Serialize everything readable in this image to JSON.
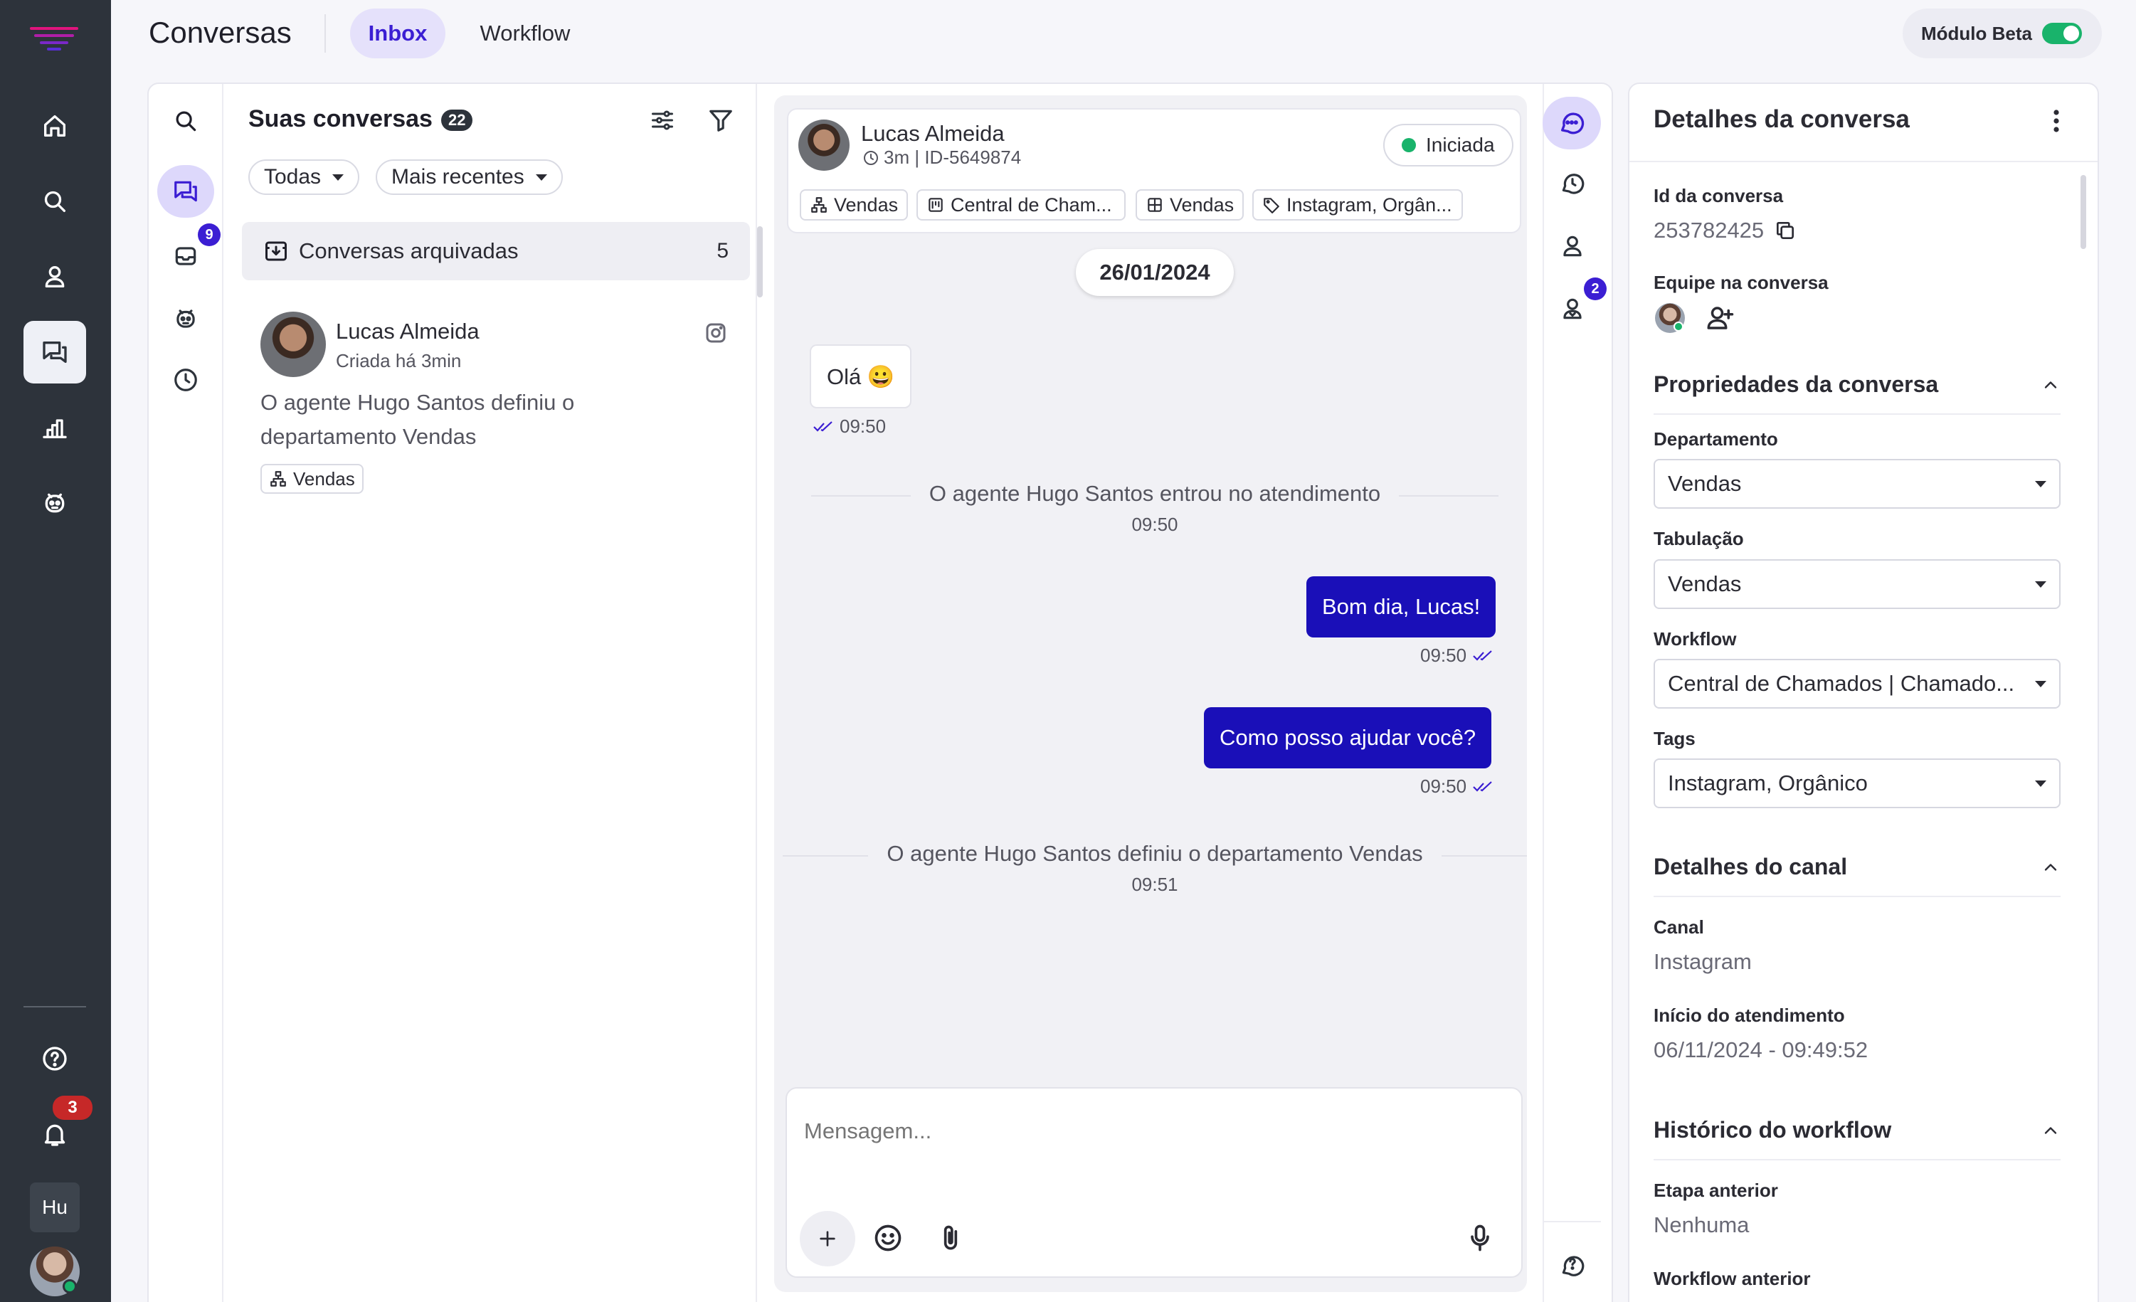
{
  "app": {
    "title": "Conversas",
    "tabs": [
      {
        "label": "Inbox"
      },
      {
        "label": "Workflow"
      }
    ],
    "beta_label": "Módulo Beta"
  },
  "colors": {
    "accent": "#3b1ed3",
    "outgoing_bubble": "#1a0fb8",
    "toggle_on": "#19b36b",
    "rail": "#2d333b",
    "notif_badge": "#c62828"
  },
  "rail": {
    "items": [
      "home-icon",
      "search-icon",
      "user-icon",
      "chat-icon",
      "chart-icon",
      "bot-icon"
    ],
    "bottom": {
      "help": "help-icon",
      "notifications_badge": "3",
      "user_initials": "Hu"
    }
  },
  "inbox_nav": {
    "inbox_badge": "9"
  },
  "list": {
    "title": "Suas conversas",
    "count": "22",
    "filter_all": "Todas",
    "sort": "Mais recentes",
    "archived_label": "Conversas arquivadas",
    "archived_count": "5",
    "items": [
      {
        "name": "Lucas Almeida",
        "created": "Criada há 3min",
        "preview": "O agente Hugo Santos definiu o departamento Vendas",
        "tag": "Vendas",
        "channel_icon": "instagram-icon"
      }
    ]
  },
  "chat": {
    "contact_name": "Lucas Almeida",
    "meta": "3m | ID-5649874",
    "status": "Iniciada",
    "chips": [
      "Vendas",
      "Central de Cham...",
      "Vendas",
      "Instagram, Orgân..."
    ],
    "date": "26/01/2024",
    "messages": {
      "m1_text": "Olá 😀",
      "m1_time": "09:50",
      "sys1_text": "O agente Hugo Santos entrou no atendimento",
      "sys1_time": "09:50",
      "m2_text": "Bom dia, Lucas!",
      "m2_time": "09:50",
      "m3_text": "Como posso ajudar você?",
      "m3_time": "09:50",
      "sys2_text": "O agente Hugo Santos definiu o departamento Vendas",
      "sys2_time": "09:51"
    },
    "composer_placeholder": "Mensagem..."
  },
  "side_tools": {
    "badge": "2"
  },
  "details": {
    "title": "Detalhes da conversa",
    "id_label": "Id da conversa",
    "id_value": "253782425",
    "team_label": "Equipe na conversa",
    "props_title": "Propriedades da conversa",
    "dept_label": "Departamento",
    "dept_value": "Vendas",
    "tab_label": "Tabulação",
    "tab_value": "Vendas",
    "wf_label": "Workflow",
    "wf_value": "Central de Chamados | Chamado...",
    "tags_label": "Tags",
    "tags_value": "Instagram, Orgânico",
    "channel_title": "Detalhes do canal",
    "canal_label": "Canal",
    "canal_value": "Instagram",
    "start_label": "Início do atendimento",
    "start_value": "06/11/2024 - 09:49:52",
    "history_title": "Histórico do workflow",
    "prev_step_label": "Etapa anterior",
    "prev_step_value": "Nenhuma",
    "prev_wf_label": "Workflow anterior"
  }
}
